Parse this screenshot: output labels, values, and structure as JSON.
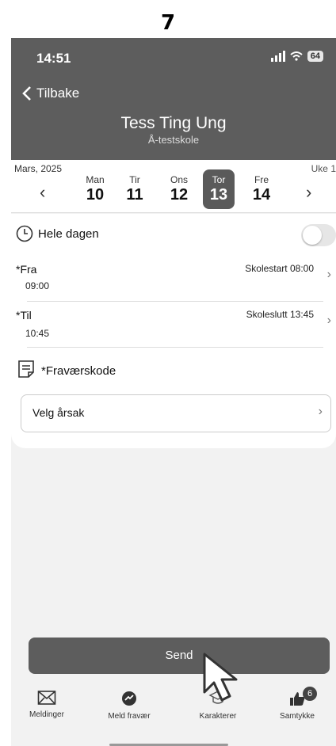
{
  "step_number": "7",
  "status": {
    "time": "14:51",
    "battery": "64"
  },
  "header": {
    "back_label": "Tilbake",
    "student_name": "Tess Ting Ung",
    "school": "Å-testskole"
  },
  "week": {
    "month": "Mars, 2025",
    "week_label": "Uke 1",
    "days": [
      {
        "name": "Man",
        "date": "10"
      },
      {
        "name": "Tir",
        "date": "11"
      },
      {
        "name": "Ons",
        "date": "12"
      },
      {
        "name": "Tor",
        "date": "13",
        "selected": true
      },
      {
        "name": "Fre",
        "date": "14"
      }
    ]
  },
  "form": {
    "all_day_label": "Hele dagen",
    "all_day_on": false,
    "from_label": "*Fra",
    "from_value": "09:00",
    "from_hint": "Skolestart 08:00",
    "to_label": "*Til",
    "to_value": "10:45",
    "to_hint": "Skoleslutt 13:45",
    "absence_code_label": "*Fraværskode",
    "reason_placeholder": "Velg årsak"
  },
  "send_label": "Send",
  "tabs": [
    {
      "label": "Meldinger",
      "icon": "envelope-icon"
    },
    {
      "label": "Meld fravær",
      "icon": "report-absence-icon"
    },
    {
      "label": "Karakterer",
      "icon": "graduation-cap-icon"
    },
    {
      "label": "Samtykke",
      "icon": "thumbs-up-icon",
      "badge": "6"
    }
  ],
  "colors": {
    "header_bg": "#5d5d5d",
    "selected_day_bg": "#5a5a5a",
    "send_bg": "#5d5d5d"
  }
}
